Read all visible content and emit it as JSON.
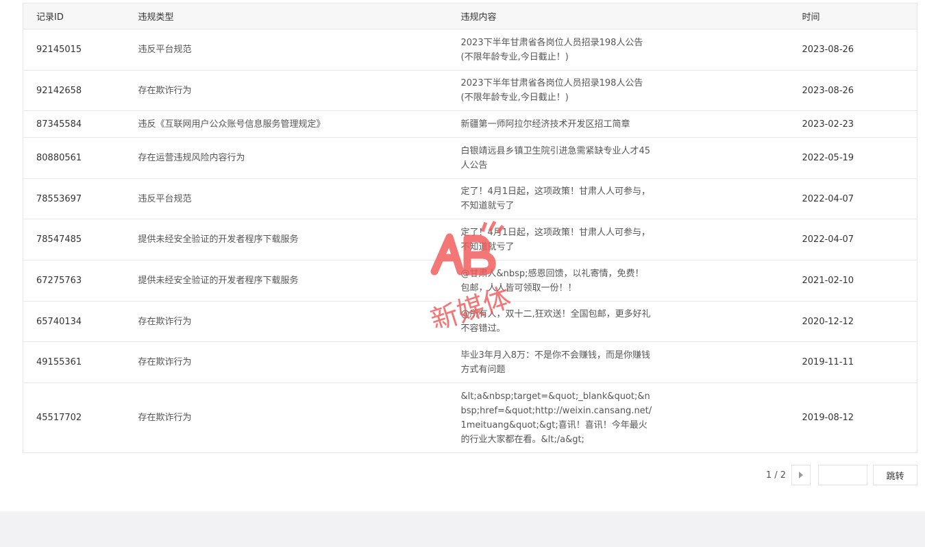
{
  "table": {
    "headers": [
      "记录ID",
      "违规类型",
      "违规内容",
      "时间"
    ],
    "rows": [
      {
        "id": "92145015",
        "type": "违反平台规范",
        "content": "2023下半年甘肃省各岗位人员招录198人公告(不限年龄专业,今日截止！)",
        "time": "2023-08-26"
      },
      {
        "id": "92142658",
        "type": "存在欺诈行为",
        "content": "2023下半年甘肃省各岗位人员招录198人公告(不限年龄专业,今日截止！)",
        "time": "2023-08-26"
      },
      {
        "id": "87345584",
        "type": "违反《互联网用户公众账号信息服务管理规定》",
        "content": "新疆第一师阿拉尔经济技术开发区招工简章",
        "time": "2023-02-23"
      },
      {
        "id": "80880561",
        "type": "存在运营违规风险内容行为",
        "content": "白银靖远县乡镇卫生院引进急需紧缺专业人才45人公告",
        "time": "2022-05-19"
      },
      {
        "id": "78553697",
        "type": "违反平台规范",
        "content": "定了！4月1日起，这项政策！甘肃人人可参与，不知道就亏了",
        "time": "2022-04-07"
      },
      {
        "id": "78547485",
        "type": "提供未经安全验证的开发者程序下载服务",
        "content": "定了！4月1日起，这项政策！甘肃人人可参与，不知道就亏了",
        "time": "2022-04-07"
      },
      {
        "id": "67275763",
        "type": "提供未经安全验证的开发者程序下载服务",
        "content": "@甘肃人&nbsp;感恩回馈，以礼寄情，免费！包邮，人人皆可领取一份！！",
        "time": "2021-02-10"
      },
      {
        "id": "65740134",
        "type": "存在欺诈行为",
        "content": "@所有人，双十二,狂欢送！全国包邮，更多好礼不容错过。",
        "time": "2020-12-12"
      },
      {
        "id": "49155361",
        "type": "存在欺诈行为",
        "content": "毕业3年月入8万：不是你不会赚钱，而是你赚钱方式有问题",
        "time": "2019-11-11"
      },
      {
        "id": "45517702",
        "type": "存在欺诈行为",
        "content": "&lt;a&nbsp;target=&quot;_blank&quot;&nbsp;href=&quot;http://weixin.cansang.net/1meituang&quot;&gt;喜讯！喜讯！今年最火的行业大家都在看。&lt;/a&gt;",
        "time": "2019-08-12"
      }
    ]
  },
  "pager": {
    "page_info": "1 / 2",
    "next_icon": "chevron-right-icon",
    "jump_value": "",
    "jump_label": "跳转"
  },
  "watermark": {
    "text": "新媒体",
    "logo_letters": "AB",
    "color": "#f25a5a"
  }
}
